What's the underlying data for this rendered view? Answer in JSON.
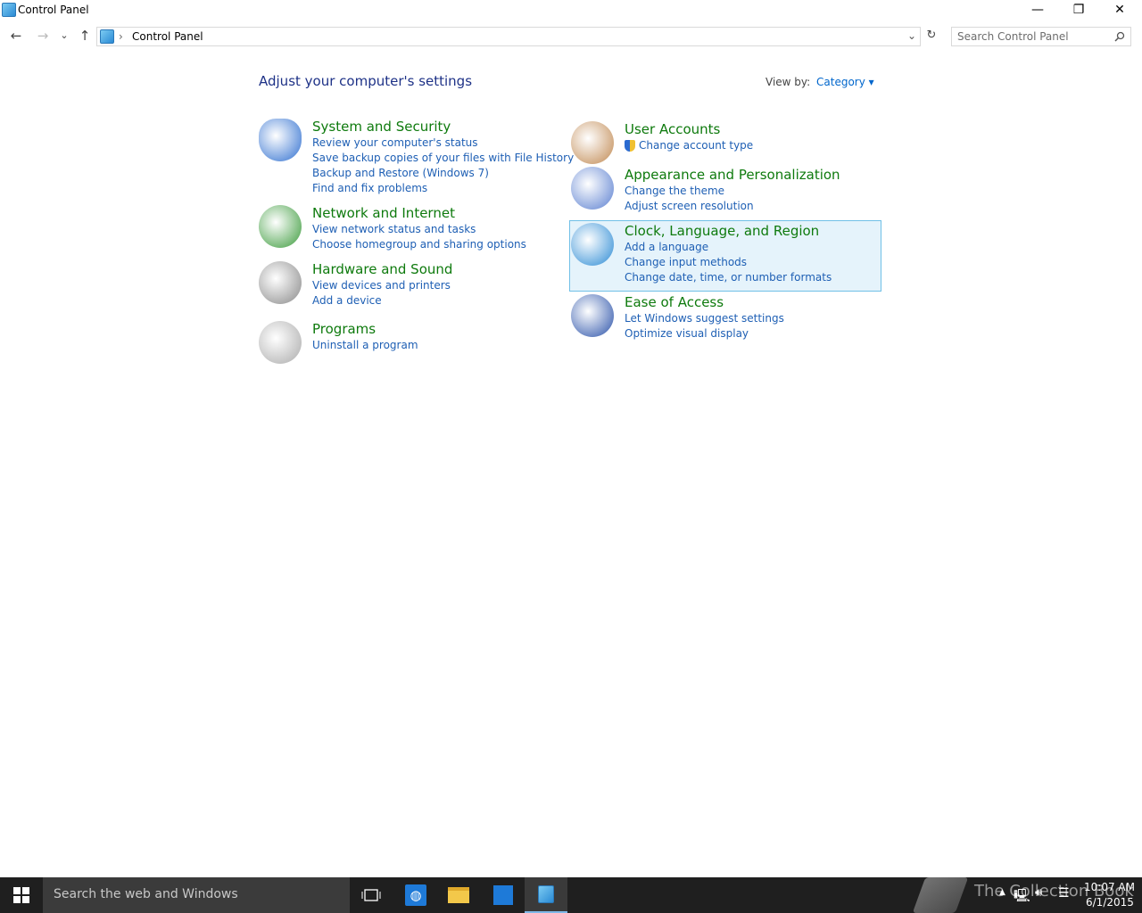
{
  "window": {
    "title": "Control Panel",
    "minimize": "—",
    "restore": "❐",
    "close": "✕"
  },
  "nav": {
    "back": "←",
    "forward": "→",
    "recent": "⌄",
    "up": "↑",
    "breadcrumb_sep": "›",
    "breadcrumb": "Control Panel",
    "dropdown": "⌄",
    "refresh": "↻"
  },
  "search": {
    "placeholder": "Search Control Panel"
  },
  "main": {
    "heading": "Adjust your computer's settings",
    "view_by_label": "View by:",
    "view_by_value": "Category ▾"
  },
  "categories": [
    {
      "title": "System and Security",
      "icon": "shield-icon",
      "links": [
        "Review your computer's status",
        "Save backup copies of your files with File History",
        "Backup and Restore (Windows 7)",
        "Find and fix problems"
      ]
    },
    {
      "title": "Network and Internet",
      "icon": "network-globe-icon",
      "links": [
        "View network status and tasks",
        "Choose homegroup and sharing options"
      ]
    },
    {
      "title": "Hardware and Sound",
      "icon": "printer-icon",
      "links": [
        "View devices and printers",
        "Add a device"
      ]
    },
    {
      "title": "Programs",
      "icon": "programs-icon",
      "links": [
        "Uninstall a program"
      ]
    },
    {
      "title": "User Accounts",
      "icon": "users-icon",
      "links": [
        "Change account type"
      ]
    },
    {
      "title": "Appearance and Personalization",
      "icon": "monitor-palette-icon",
      "links": [
        "Change the theme",
        "Adjust screen resolution"
      ]
    },
    {
      "title": "Clock, Language, and Region",
      "icon": "clock-globe-icon",
      "links": [
        "Add a language",
        "Change input methods",
        "Change date, time, or number formats"
      ]
    },
    {
      "title": "Ease of Access",
      "icon": "ease-of-access-icon",
      "links": [
        "Let Windows suggest settings",
        "Optimize visual display"
      ]
    }
  ],
  "taskbar": {
    "search_placeholder": "Search the web and Windows",
    "time": "10:07 AM",
    "date": "6/1/2015",
    "watermark": "The Collection Book"
  },
  "colors": {
    "heading": "#1e3287",
    "category_title": "#0e7a0d",
    "link": "#1e5fb4",
    "highlight": "#e5f3fb",
    "taskbar": "#1f1f1f"
  }
}
